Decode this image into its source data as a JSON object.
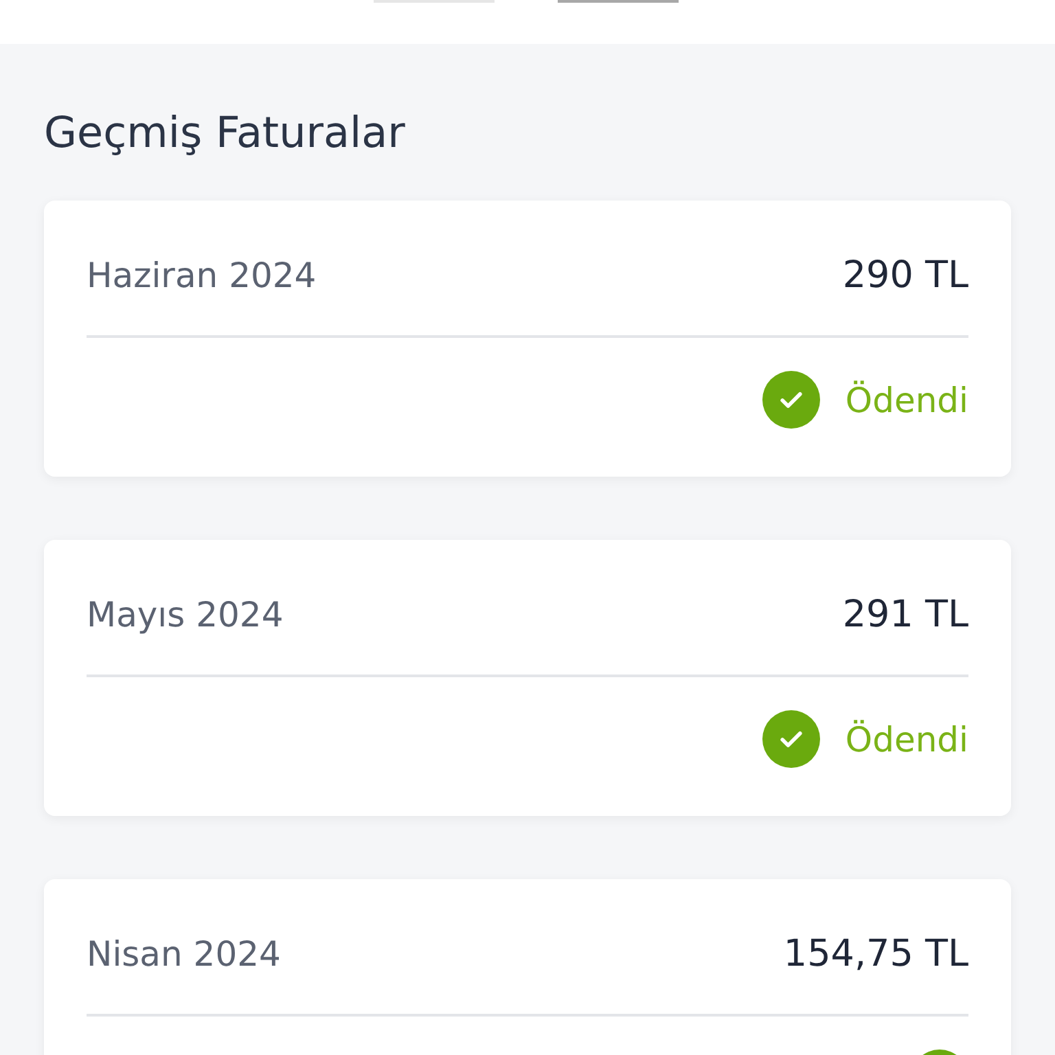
{
  "title": "Geçmiş Faturalar",
  "bills": [
    {
      "period": "Haziran 2024",
      "amount": "290 TL",
      "status": {
        "paid": true,
        "label": "Ödendi"
      }
    },
    {
      "period": "Mayıs 2024",
      "amount": "291 TL",
      "status": {
        "paid": true,
        "label": "Ödendi"
      }
    },
    {
      "period": "Nisan 2024",
      "amount": "154,75 TL",
      "status": {
        "paid": true
      }
    }
  ]
}
